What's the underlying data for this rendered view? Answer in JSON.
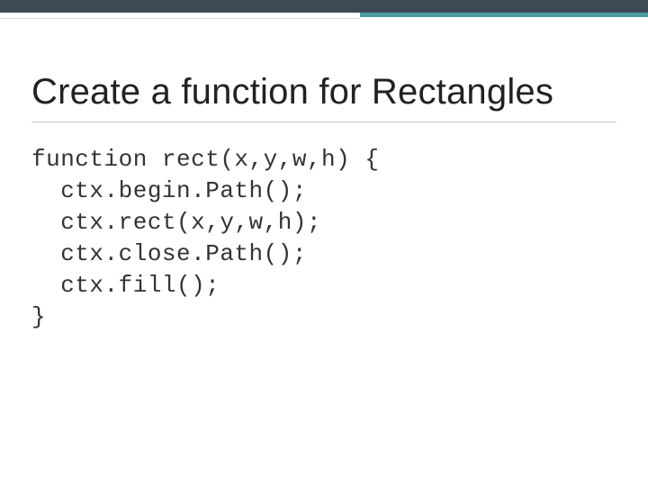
{
  "slide": {
    "title": "Create a function for Rectangles",
    "code": {
      "line1": "function rect(x,y,w,h) {",
      "line2": "  ctx.begin.Path();",
      "line3": "  ctx.rect(x,y,w,h);",
      "line4": "  ctx.close.Path();",
      "line5": "  ctx.fill();",
      "line6": "}"
    }
  }
}
